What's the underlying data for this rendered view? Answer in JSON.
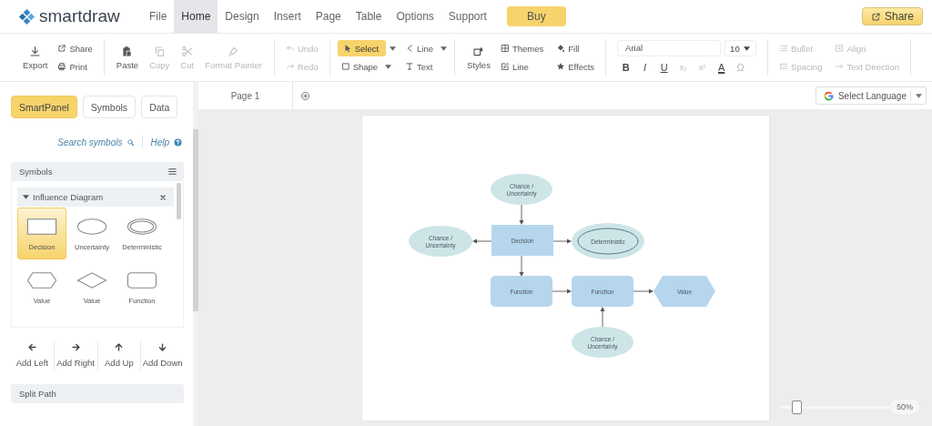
{
  "logo": "**smart**draw",
  "menu": [
    {
      "label": "File",
      "selected": false
    },
    {
      "label": "Home",
      "selected": true
    },
    {
      "label": "Design",
      "selected": false
    },
    {
      "label": "Insert",
      "selected": false
    },
    {
      "label": "Page",
      "selected": false
    },
    {
      "label": "Table",
      "selected": false
    },
    {
      "label": "Options",
      "selected": false
    },
    {
      "label": "Support",
      "selected": false
    }
  ],
  "buy_button": "Buy",
  "share_button": "Share",
  "ribbon": [
    {
      "kind": "buttons",
      "items": [
        {
          "kind": "big",
          "label": "Export",
          "disabled": false
        },
        {
          "kind": "small",
          "label": "Share",
          "disabled": false
        },
        {
          "kind": "small",
          "label": "Print",
          "disabled": false
        }
      ]
    },
    {
      "kind": "buttons",
      "items": [
        {
          "kind": "big",
          "label": "Paste",
          "disabled": false
        },
        {
          "kind": "big",
          "label": "Copy",
          "disabled": true
        },
        {
          "kind": "big",
          "label": "Cut",
          "disabled": true
        },
        {
          "kind": "big",
          "label": "Format Painter",
          "disabled": true
        }
      ]
    },
    {
      "kind": "buttons",
      "items": [
        {
          "kind": "small",
          "label": "Undo",
          "disabled": true
        },
        {
          "kind": "small",
          "label": "Redo",
          "disabled": true
        }
      ]
    },
    {
      "kind": "buttons",
      "items": [
        {
          "kind": "small",
          "label": "Select",
          "disabled": false,
          "selected": true,
          "dropdown": true
        },
        {
          "kind": "small",
          "label": "Shape",
          "disabled": false,
          "selected": false,
          "dropdown": true
        },
        {
          "kind": "small",
          "label": "Line",
          "disabled": false,
          "selected": false,
          "dropdown": true
        },
        {
          "kind": "small",
          "label": "Text",
          "disabled": false,
          "selected": false,
          "dropdown": false
        }
      ]
    },
    {
      "kind": "buttons",
      "items": [
        {
          "kind": "big",
          "label": "Styles",
          "disabled": false
        },
        {
          "kind": "small",
          "label": "Themes",
          "disabled": false
        },
        {
          "kind": "small",
          "label": "Line",
          "disabled": false
        },
        {
          "kind": "small",
          "label": "Fill",
          "disabled": false
        },
        {
          "kind": "small",
          "label": "Effects",
          "disabled": false
        }
      ]
    },
    {
      "kind": "font",
      "font": "Arial",
      "size": "10",
      "formats": [
        {
          "kind": "bold",
          "label": "B",
          "disabled": false
        },
        {
          "kind": "italic",
          "label": "I",
          "disabled": false
        },
        {
          "kind": "underline",
          "label": "U",
          "disabled": false
        },
        {
          "kind": "sub",
          "label": "x₂",
          "disabled": true
        },
        {
          "kind": "sup",
          "label": "x²",
          "disabled": true
        },
        {
          "kind": "color",
          "label": "A",
          "disabled": false
        },
        {
          "kind": "symbol",
          "label": "Ω",
          "disabled": true
        }
      ]
    },
    {
      "kind": "buttons",
      "items": [
        {
          "kind": "small",
          "label": "Bullet",
          "disabled": true
        },
        {
          "kind": "small",
          "label": "Spacing",
          "disabled": true
        },
        {
          "kind": "small",
          "label": "Align",
          "disabled": true
        },
        {
          "kind": "small",
          "label": "Text Direction",
          "disabled": true
        }
      ]
    }
  ],
  "panel": {
    "tabs": [
      {
        "label": "SmartPanel",
        "selected": true
      },
      {
        "label": "Symbols",
        "selected": false
      },
      {
        "label": "Data",
        "selected": false
      }
    ],
    "search_link": "Search symbols",
    "help_link": "Help",
    "symbols_header": "Symbols",
    "library": {
      "title": "Influence Diagram",
      "expanded": true,
      "symbols": [
        {
          "kind": "rectangle",
          "label": "Decision",
          "selected": true
        },
        {
          "kind": "ellipse",
          "label": "Uncertainty",
          "selected": false
        },
        {
          "kind": "double-ellipse",
          "label": "Deterministic",
          "selected": false
        },
        {
          "kind": "hexagon",
          "label": "Value",
          "selected": false
        },
        {
          "kind": "diamond",
          "label": "Value",
          "selected": false
        },
        {
          "kind": "rounded-rectangle",
          "label": "Function",
          "selected": false
        }
      ]
    },
    "add_buttons": [
      {
        "kind": "left",
        "label": "Add Left"
      },
      {
        "kind": "right",
        "label": "Add Right"
      },
      {
        "kind": "up",
        "label": "Add Up"
      },
      {
        "kind": "down",
        "label": "Add Down"
      }
    ],
    "split_path_header": "Split Path"
  },
  "page_tab": {
    "label": "Page 1"
  },
  "language_select": "Select Language",
  "diagram": {
    "nodes": [
      {
        "kind": "ellipse",
        "lines": [
          "Chance /",
          "Uncertainty"
        ]
      },
      {
        "kind": "ellipse",
        "lines": [
          "Chance /",
          "Uncertainty"
        ]
      },
      {
        "kind": "rectangle",
        "lines": [
          "Decision"
        ]
      },
      {
        "kind": "double-ellipse",
        "lines": [
          "Deterministic"
        ]
      },
      {
        "kind": "rounded-rectangle",
        "lines": [
          "Function"
        ]
      },
      {
        "kind": "rounded-rectangle",
        "lines": [
          "Function"
        ]
      },
      {
        "kind": "hexagon",
        "lines": [
          "Value"
        ]
      },
      {
        "kind": "ellipse",
        "lines": [
          "Chance /",
          "Uncertainty"
        ]
      }
    ]
  },
  "zoom": {
    "level": 0.1,
    "reading": "60%"
  }
}
